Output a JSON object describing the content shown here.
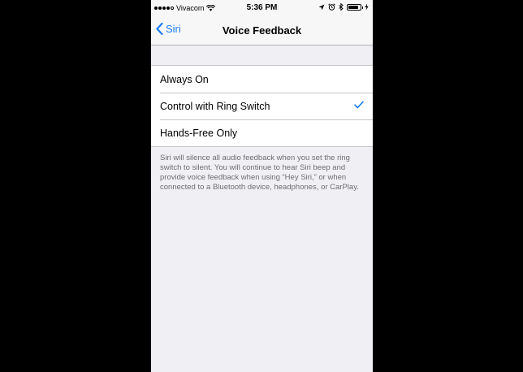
{
  "status_bar": {
    "carrier": "Vivacom",
    "time": "5:36 PM",
    "signal_bars": 4,
    "battery_level": 0.85
  },
  "nav": {
    "back_label": "Siri",
    "title": "Voice Feedback"
  },
  "options": [
    {
      "label": "Always On",
      "selected": false
    },
    {
      "label": "Control with Ring Switch",
      "selected": true
    },
    {
      "label": "Hands-Free Only",
      "selected": false
    }
  ],
  "footer": "Siri will silence all audio feedback when you set the ring switch to silent. You will continue to hear Siri beep and provide voice feedback when using “Hey Siri,” or when connected to a Bluetooth device, headphones, or CarPlay.",
  "colors": {
    "accent": "#1a7cf5",
    "background": "#efeff4",
    "footer_text": "#6d6d72"
  },
  "icons": {
    "back": "chevron-left-icon",
    "check": "checkmark-icon"
  }
}
